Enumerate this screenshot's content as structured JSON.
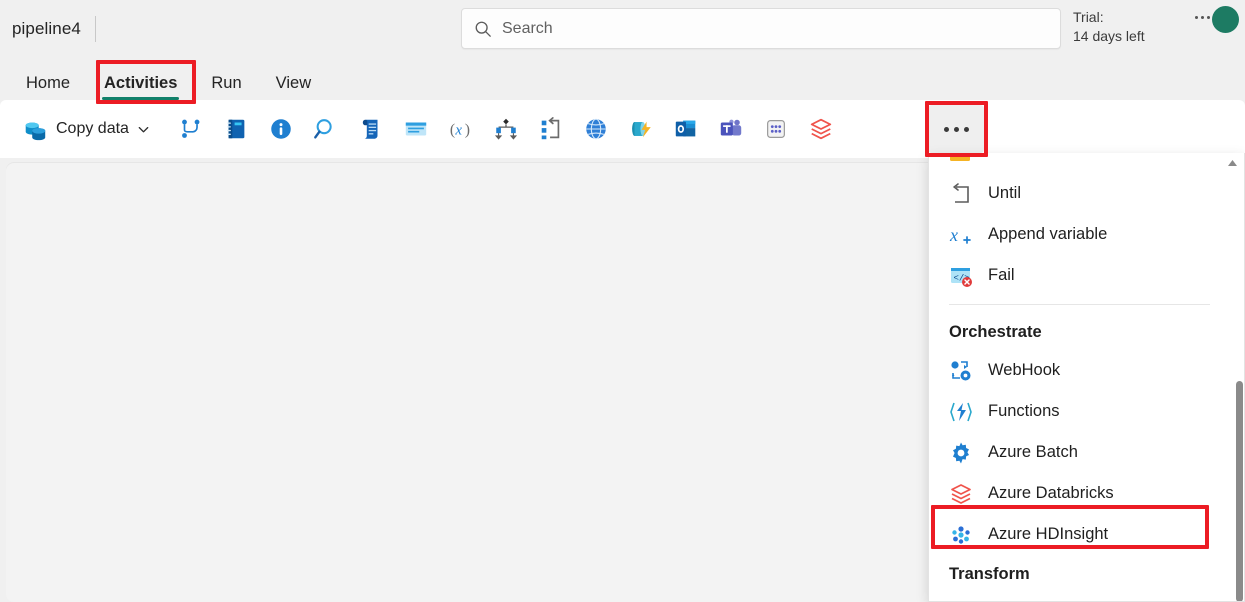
{
  "header": {
    "pipeline_name": "pipeline4",
    "search": {
      "placeholder": "Search",
      "icon": "search-icon"
    },
    "trial_line1": "Trial:",
    "trial_line2": "14 days left",
    "avatar_color": "#1d7b63"
  },
  "tabs": [
    {
      "label": "Home",
      "active": false
    },
    {
      "label": "Activities",
      "active": true
    },
    {
      "label": "Run",
      "active": false
    },
    {
      "label": "View",
      "active": false
    }
  ],
  "ribbon": {
    "copy_data": {
      "label": "Copy data",
      "icon": "copy-data-icon",
      "chevron": "chevron-down-icon"
    },
    "items": [
      {
        "icon": "pipeline-branch-icon",
        "name": "invoke-pipeline"
      },
      {
        "icon": "notebook-icon",
        "name": "notebook"
      },
      {
        "icon": "info-circle-icon",
        "name": "get-metadata"
      },
      {
        "icon": "magnifier-icon",
        "name": "lookup"
      },
      {
        "icon": "script-scroll-icon",
        "name": "script"
      },
      {
        "icon": "stored-procedure-icon",
        "name": "stored-procedure"
      },
      {
        "icon": "set-variable-x-icon",
        "name": "set-variable"
      },
      {
        "icon": "switch-branch-icon",
        "name": "switch"
      },
      {
        "icon": "foreach-loop-icon",
        "name": "foreach"
      },
      {
        "icon": "globe-icon",
        "name": "web"
      },
      {
        "icon": "azure-function-icon",
        "name": "azure-function"
      },
      {
        "icon": "outlook-icon",
        "name": "office365-outlook"
      },
      {
        "icon": "teams-icon",
        "name": "teams"
      },
      {
        "icon": "dataflow-grid-icon",
        "name": "dataflow"
      },
      {
        "icon": "databricks-icon",
        "name": "azure-databricks"
      }
    ],
    "overflow_label": "More options"
  },
  "menu": {
    "items": [
      {
        "type": "item",
        "label": "Until",
        "icon": "until-loop-icon"
      },
      {
        "type": "item",
        "label": "Append variable",
        "icon": "append-variable-icon"
      },
      {
        "type": "item",
        "label": "Fail",
        "icon": "fail-icon"
      },
      {
        "type": "separator"
      },
      {
        "type": "header",
        "label": "Orchestrate"
      },
      {
        "type": "item",
        "label": "WebHook",
        "icon": "webhook-icon"
      },
      {
        "type": "item",
        "label": "Functions",
        "icon": "azure-functions-icon"
      },
      {
        "type": "item",
        "label": "Azure Batch",
        "icon": "gear-icon"
      },
      {
        "type": "item",
        "label": "Azure Databricks",
        "icon": "databricks-icon"
      },
      {
        "type": "item",
        "label": "Azure HDInsight",
        "icon": "hdinsight-icon",
        "highlighted": true
      },
      {
        "type": "header",
        "label": "Transform"
      }
    ],
    "scroll_up_icon": "chevron-up-icon"
  },
  "annotations": {
    "color": "#ec1c24",
    "boxes": [
      "activities-tab",
      "overflow-button",
      "azure-hdinsight-menu-item"
    ]
  }
}
